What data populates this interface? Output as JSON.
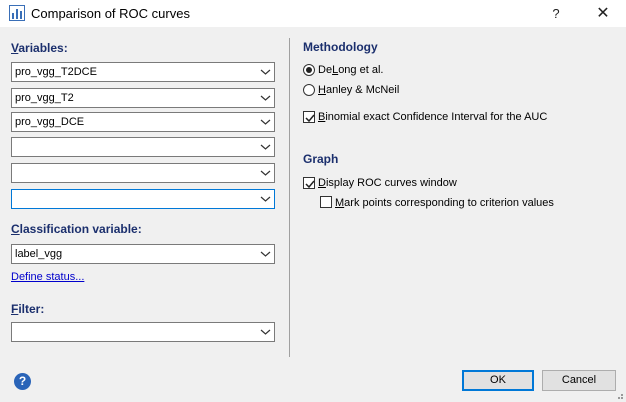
{
  "window": {
    "title": "Comparison of ROC curves",
    "help_glyph": "?",
    "close_glyph": "✕"
  },
  "variables": {
    "label_pre": "V",
    "label_rest": "ariables:",
    "fields": [
      "pro_vgg_T2DCE",
      "pro_vgg_T2",
      "pro_vgg_DCE",
      "",
      "",
      ""
    ]
  },
  "classification": {
    "label_pre": "C",
    "label_rest": "lassification variable:",
    "value": "label_vgg",
    "define_status": "Define status..."
  },
  "filter": {
    "label_pre": "F",
    "label_rest": "ilter:",
    "value": ""
  },
  "methodology": {
    "heading": "Methodology",
    "opt1_pre": "De",
    "opt1_u": "L",
    "opt1_post": "ong et al.",
    "opt2_u": "H",
    "opt2_post": "anley & McNeil",
    "binom_u": "B",
    "binom_post": "inomial exact Confidence Interval for the AUC",
    "selected": "DeLong et al.",
    "binomial_checked": true
  },
  "graph": {
    "heading": "Graph",
    "display_u": "D",
    "display_post": "isplay ROC curves window",
    "mark_u": "M",
    "mark_post": "ark points corresponding to criterion values",
    "display_checked": true,
    "mark_checked": false
  },
  "footer": {
    "help_glyph": "?",
    "ok": "OK",
    "cancel": "Cancel"
  },
  "colors": {
    "heading": "#1b2f6d",
    "focus": "#0078d7",
    "link": "#0000cc"
  }
}
